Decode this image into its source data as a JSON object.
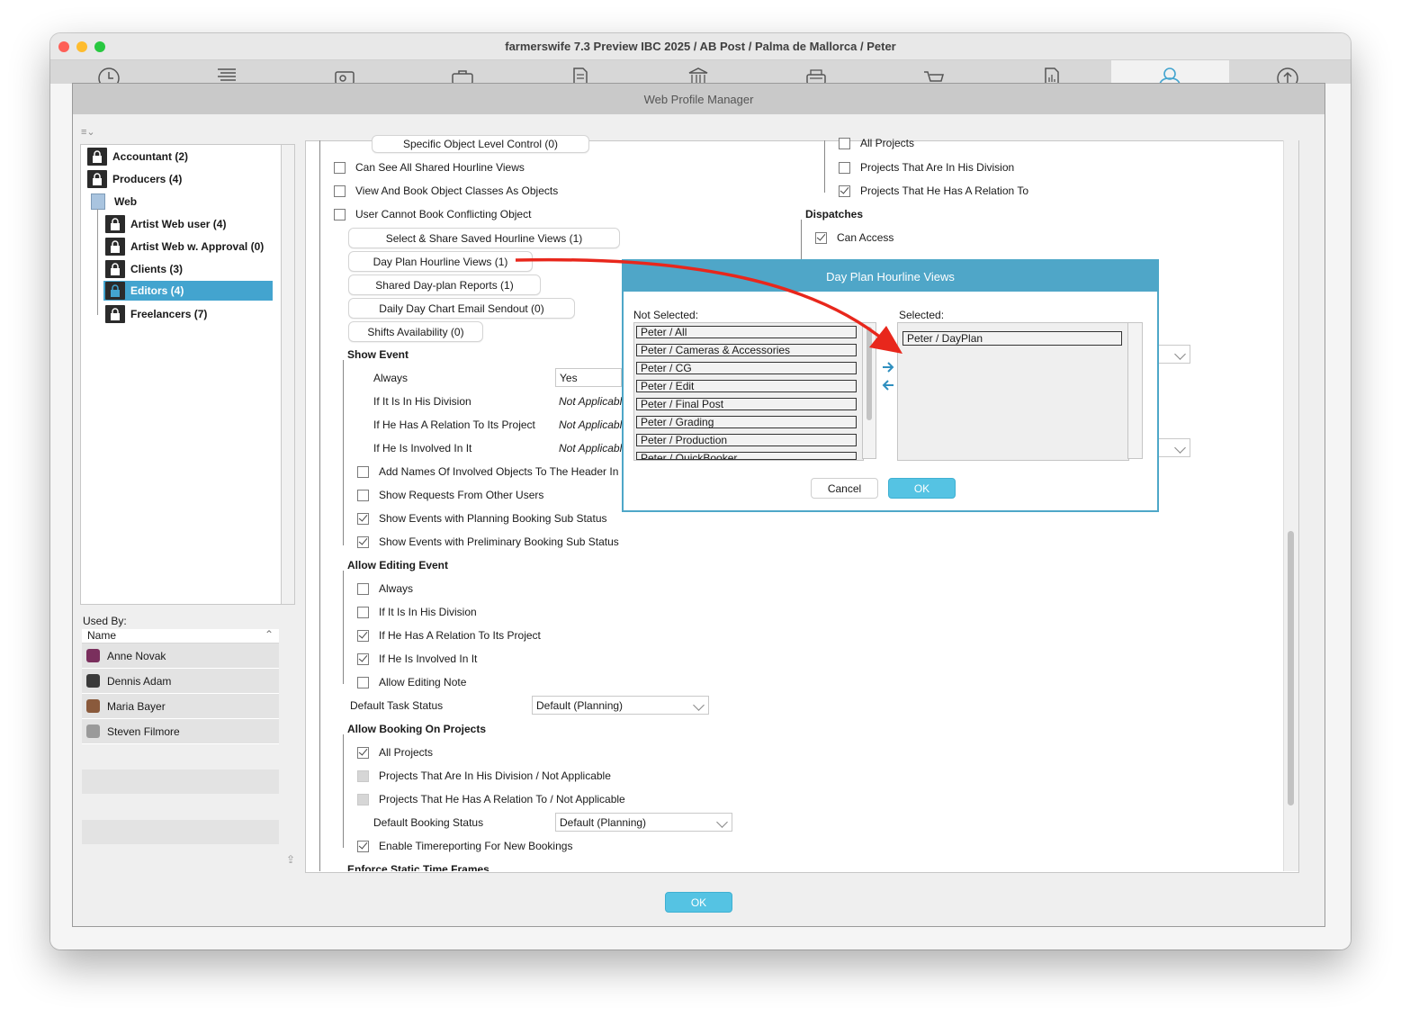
{
  "window": {
    "title": "farmerswife 7.3  Preview IBC 2025 / AB Post / Palma de Mallorca / Peter"
  },
  "toolbar": {
    "icons": [
      "clock-icon",
      "list-icon",
      "camera-icon",
      "briefcase-icon",
      "document-icon",
      "bank-icon",
      "typewriter-icon",
      "cart-icon",
      "report-icon",
      "user-icon",
      "upload-icon"
    ],
    "active": "user-icon"
  },
  "sheet": {
    "title": "Web Profile Manager",
    "ok_label": "OK"
  },
  "tree": {
    "items": [
      {
        "label": "Accountant (2)",
        "type": "lock"
      },
      {
        "label": "Producers (4)",
        "type": "lock"
      },
      {
        "label": "Web",
        "type": "folder"
      },
      {
        "label": "Artist Web user (4)",
        "type": "lock"
      },
      {
        "label": "Artist Web w. Approval (0)",
        "type": "lock"
      },
      {
        "label": "Clients (3)",
        "type": "lock"
      },
      {
        "label": "Editors (4)",
        "type": "lock",
        "selected": true
      },
      {
        "label": "Freelancers (7)",
        "type": "lock"
      }
    ]
  },
  "used_by": {
    "label": "Used By:",
    "column": "Name",
    "users": [
      "Anne Novak",
      "Dennis Adam",
      "Maria Bayer",
      "Steven Filmore"
    ]
  },
  "main": {
    "pill_top": "Specific Object Level Control (0)",
    "col1": {
      "can_see_shared": "Can See All Shared Hourline Views",
      "view_book_classes": "View And Book Object Classes As Objects",
      "user_cannot_book": "User Cannot Book Conflicting Object",
      "select_share": "Select & Share Saved Hourline Views (1)",
      "day_plan": "Day Plan Hourline Views (1)",
      "shared_dayplan": "Shared Day-plan Reports (1)",
      "daily_day_chart": "Daily Day Chart Email Sendout (0)",
      "shifts": "Shifts Availability (0)",
      "show_event": "Show Event",
      "se_always": "Always",
      "se_always_val": "Yes",
      "se_division": "If It Is In His Division",
      "se_relation": "If He Has A Relation To Its Project",
      "se_involved": "If He Is Involved In It",
      "not_applicable": "Not Applicable",
      "add_names": "Add Names Of Involved Objects To The Header In",
      "show_requests": "Show Requests From Other Users",
      "show_planning": "Show Events with Planning Booking Sub Status",
      "show_prelim": "Show Events with Preliminary Booking Sub Status",
      "allow_editing": "Allow Editing Event",
      "ae_always": "Always",
      "ae_division": "If It Is In His Division",
      "ae_relation": "If He Has A Relation To Its Project",
      "ae_involved": "If He Is Involved In It",
      "ae_note": "Allow Editing Note",
      "default_task_status": "Default Task Status",
      "default_task_value": "Default (Planning)",
      "allow_booking": "Allow Booking On Projects",
      "ab_all": "All Projects",
      "ab_division": "Projects That Are In His Division / Not Applicable",
      "ab_relation": "Projects That He Has A Relation To / Not Applicable",
      "default_booking_status": "Default Booking Status",
      "default_booking_value": "Default (Planning)",
      "enable_timereporting": "Enable Timereporting For New Bookings",
      "enforce_static": "Enforce Static Time Frames"
    },
    "col2": {
      "all_projects": "All Projects",
      "in_division": "Projects That Are In His Division",
      "relation_to": "Projects That He Has A Relation To",
      "dispatches": "Dispatches",
      "can_access": "Can Access"
    }
  },
  "dialog": {
    "title": "Day Plan Hourline Views",
    "not_selected_label": "Not Selected:",
    "selected_label": "Selected:",
    "not_selected": [
      "Peter / All",
      "Peter / Cameras & Accessories",
      "Peter / CG",
      "Peter / Edit",
      "Peter / Final Post",
      "Peter / Grading",
      "Peter / Production",
      "Peter / QuickBooker"
    ],
    "selected": [
      "Peter / DayPlan"
    ],
    "cancel_label": "Cancel",
    "ok_label": "OK"
  },
  "colors": {
    "accent": "#43a4cf",
    "ok_button": "#55c3e3",
    "annotation_arrow": "#e8271c"
  }
}
